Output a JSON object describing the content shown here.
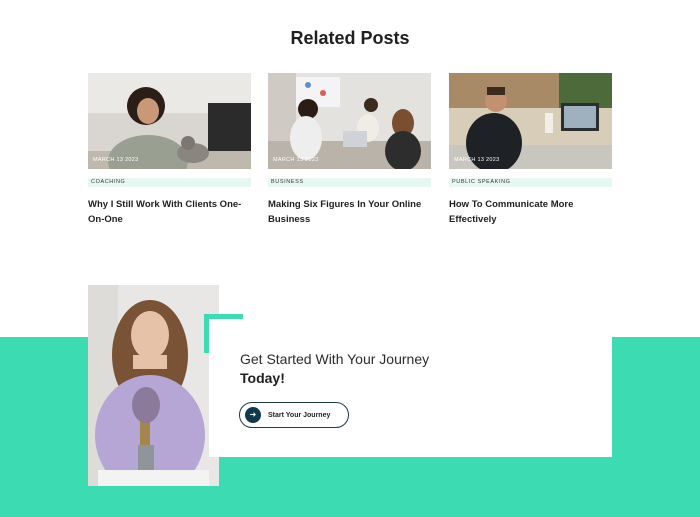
{
  "related": {
    "title": "Related Posts",
    "posts": [
      {
        "date": "MARCH 13 2023",
        "category": "COACHING",
        "title": "Why I Still Work With Clients One-On-One"
      },
      {
        "date": "MARCH 13 2023",
        "category": "BUSINESS",
        "title": "Making Six Figures In Your Online Business"
      },
      {
        "date": "MARCH 13 2023",
        "category": "PUBLIC SPEAKING",
        "title": "How To Communicate More Effectively"
      }
    ]
  },
  "cta": {
    "line1": "Get Started With Your Journey",
    "line2": "Today!",
    "button_label": "Start Your Journey",
    "button_icon": "arrow-right-icon"
  },
  "colors": {
    "accent": "#3ddbb2",
    "category_bg": "#e7f8f2",
    "button_dark": "#0f3a4d"
  }
}
